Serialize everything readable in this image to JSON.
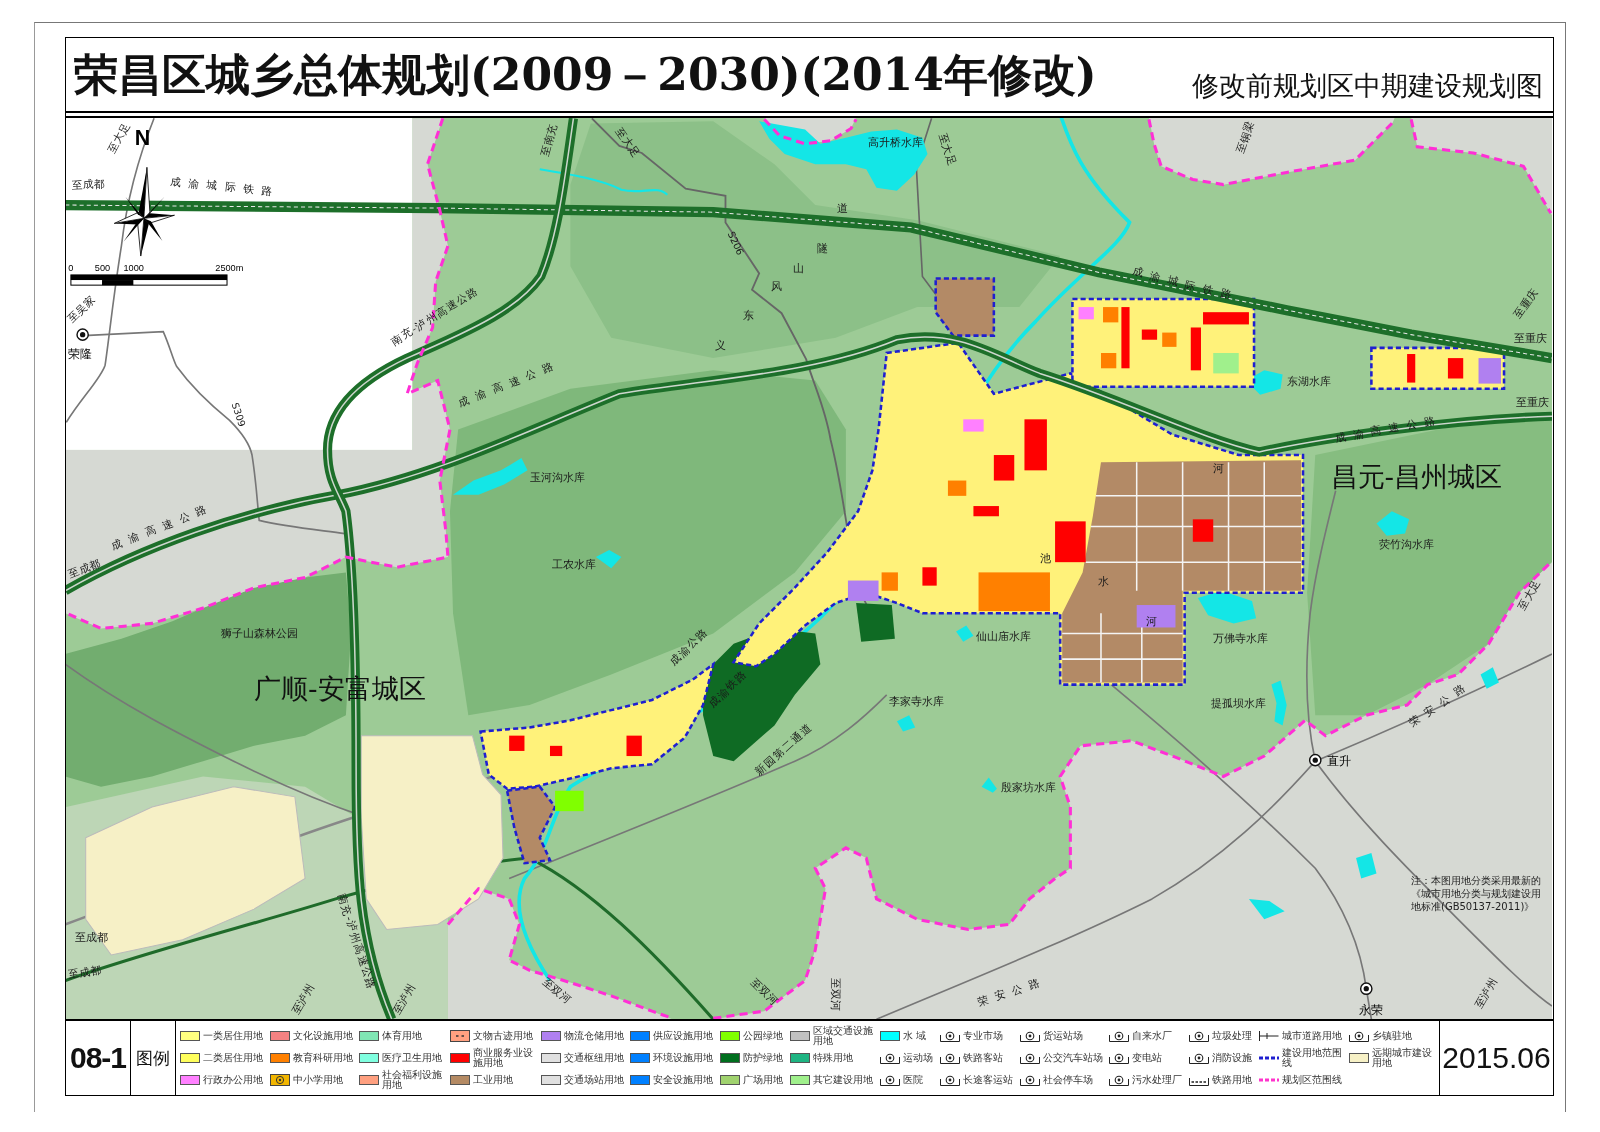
{
  "title": {
    "main": "荣昌区城乡总体规划(2009－2030)(2014年修改)",
    "subtitle": "修改前规划区中期建设规划图"
  },
  "map": {
    "north": "N",
    "scale_labels": [
      "0",
      "500",
      "1000",
      "2500m"
    ],
    "labels": [
      {
        "text": "至大足",
        "kind": "direction"
      },
      {
        "text": "至成都",
        "kind": "direction"
      },
      {
        "text": "成渝城际铁路",
        "kind": "road"
      },
      {
        "text": "至吴家",
        "kind": "direction"
      },
      {
        "text": "荣隆",
        "kind": "town"
      },
      {
        "text": "南充-泸州高速公路",
        "kind": "highway"
      },
      {
        "text": "S309",
        "kind": "code"
      },
      {
        "text": "成渝高速公路",
        "kind": "road"
      },
      {
        "text": "玉河沟水库",
        "kind": "water"
      },
      {
        "text": "至成都",
        "kind": "direction"
      },
      {
        "text": "成渝高速公路",
        "kind": "road"
      },
      {
        "text": "至南充",
        "kind": "direction"
      },
      {
        "text": "至大足",
        "kind": "direction"
      },
      {
        "text": "高升桥水库",
        "kind": "water"
      },
      {
        "text": "至大足",
        "kind": "direction"
      },
      {
        "text": "S206",
        "kind": "code"
      },
      {
        "text": "义",
        "kind": "tunnel"
      },
      {
        "text": "东",
        "kind": "tunnel"
      },
      {
        "text": "风",
        "kind": "tunnel"
      },
      {
        "text": "山",
        "kind": "tunnel"
      },
      {
        "text": "隧",
        "kind": "tunnel"
      },
      {
        "text": "道",
        "kind": "tunnel"
      },
      {
        "text": "成渝城际铁路",
        "kind": "road"
      },
      {
        "text": "至铜梁",
        "kind": "direction"
      },
      {
        "text": "东湖水库",
        "kind": "water"
      },
      {
        "text": "至重庆",
        "kind": "direction"
      },
      {
        "text": "至重庆",
        "kind": "direction"
      },
      {
        "text": "成渝高速公路",
        "kind": "road"
      },
      {
        "text": "至重庆",
        "kind": "direction"
      },
      {
        "text": "昌元-昌州城区",
        "kind": "district"
      },
      {
        "text": "荧竹沟水库",
        "kind": "water"
      },
      {
        "text": "河",
        "kind": "river"
      },
      {
        "text": "池",
        "kind": "river"
      },
      {
        "text": "水",
        "kind": "river"
      },
      {
        "text": "河",
        "kind": "river"
      },
      {
        "text": "仙山庙水库",
        "kind": "water"
      },
      {
        "text": "万佛寺水库",
        "kind": "water"
      },
      {
        "text": "至大足",
        "kind": "direction"
      },
      {
        "text": "工农水库",
        "kind": "water"
      },
      {
        "text": "狮子山森林公园",
        "kind": "park"
      },
      {
        "text": "广顺-安富城区",
        "kind": "district"
      },
      {
        "text": "成渝公路",
        "kind": "highway"
      },
      {
        "text": "成渝铁路",
        "kind": "highway"
      },
      {
        "text": "李家寺水库",
        "kind": "water"
      },
      {
        "text": "提孤坝水库",
        "kind": "water"
      },
      {
        "text": "荣安公路",
        "kind": "road"
      },
      {
        "text": "直升",
        "kind": "town"
      },
      {
        "text": "新园第二通道",
        "kind": "highway"
      },
      {
        "text": "殷家坊水库",
        "kind": "water"
      },
      {
        "text": "至成都",
        "kind": "direction"
      },
      {
        "text": "至成都",
        "kind": "direction"
      },
      {
        "text": "南充-泸州高速公路",
        "kind": "highway"
      },
      {
        "text": "至泸州",
        "kind": "direction"
      },
      {
        "text": "至泸州",
        "kind": "direction"
      },
      {
        "text": "至双河",
        "kind": "direction"
      },
      {
        "text": "至双河",
        "kind": "direction"
      },
      {
        "text": "至双河",
        "kind": "direction"
      },
      {
        "text": "荣安公路",
        "kind": "road"
      },
      {
        "text": "永荣",
        "kind": "town"
      },
      {
        "text": "至泸州",
        "kind": "direction"
      }
    ],
    "note": "注：本图用地分类采用最新的《城市用地分类与规划建设用地标准(GB50137-2011)》"
  },
  "footer": {
    "sheet_number": "08-1",
    "legend_title": "图例",
    "legend": [
      {
        "label": "一类居住用地",
        "kind": "swatch",
        "color": "#ffff80"
      },
      {
        "label": "二类居住用地",
        "kind": "swatch",
        "color": "#ffff5c"
      },
      {
        "label": "行政办公用地",
        "kind": "swatch",
        "color": "#ff80ff"
      },
      {
        "label": "文化设施用地",
        "kind": "swatch",
        "color": "#f58282"
      },
      {
        "label": "教育科研用地",
        "kind": "swatch",
        "color": "#ff8000"
      },
      {
        "label": "中小学用地",
        "kind": "symbol-swatch",
        "color": "#f2b600"
      },
      {
        "label": "体育用地",
        "kind": "swatch",
        "color": "#80e6b4"
      },
      {
        "label": "医疗卫生用地",
        "kind": "swatch",
        "color": "#80ffe0"
      },
      {
        "label": "社会福利设施用地",
        "kind": "swatch",
        "color": "#ffa080"
      },
      {
        "label": "文物古迹用地",
        "kind": "hatched",
        "color": "#ffa080"
      },
      {
        "label": "商业服务业设施用地",
        "kind": "swatch",
        "color": "#ff0000"
      },
      {
        "label": "工业用地",
        "kind": "swatch",
        "color": "#b48a64"
      },
      {
        "label": "物流仓储用地",
        "kind": "swatch",
        "color": "#b080f0"
      },
      {
        "label": "交通枢纽用地",
        "kind": "swatch",
        "color": "#e0e0e0"
      },
      {
        "label": "交通场站用地",
        "kind": "swatch",
        "color": "#e0e0e0"
      },
      {
        "label": "供应设施用地",
        "kind": "swatch",
        "color": "#0080ff"
      },
      {
        "label": "环境设施用地",
        "kind": "swatch",
        "color": "#0080ff"
      },
      {
        "label": "安全设施用地",
        "kind": "swatch",
        "color": "#0080ff"
      },
      {
        "label": "公园绿地",
        "kind": "swatch",
        "color": "#80ff00"
      },
      {
        "label": "防护绿地",
        "kind": "swatch",
        "color": "#006e1e"
      },
      {
        "label": "广场用地",
        "kind": "swatch",
        "color": "#a0d26e"
      },
      {
        "label": "区域交通设施用地",
        "kind": "swatch",
        "color": "#c0c0c0"
      },
      {
        "label": "特殊用地",
        "kind": "swatch",
        "color": "#1eb482"
      },
      {
        "label": "其它建设用地",
        "kind": "swatch",
        "color": "#a0f08c"
      },
      {
        "label": "水 域",
        "kind": "swatch",
        "color": "#00ffff"
      },
      {
        "label": "运动场",
        "kind": "symbol"
      },
      {
        "label": "医院",
        "kind": "symbol"
      },
      {
        "label": "专业市场",
        "kind": "symbol"
      },
      {
        "label": "铁路客站",
        "kind": "symbol"
      },
      {
        "label": "长途客运站",
        "kind": "symbol"
      },
      {
        "label": "货运站场",
        "kind": "symbol"
      },
      {
        "label": "公交汽车站场",
        "kind": "symbol"
      },
      {
        "label": "社会停车场",
        "kind": "symbol"
      },
      {
        "label": "自来水厂",
        "kind": "symbol"
      },
      {
        "label": "变电站",
        "kind": "symbol"
      },
      {
        "label": "污水处理厂",
        "kind": "symbol"
      },
      {
        "label": "垃圾处理",
        "kind": "symbol"
      },
      {
        "label": "消防设施",
        "kind": "symbol"
      },
      {
        "label": "铁路用地",
        "kind": "rail-line"
      },
      {
        "label": "城市道路用地",
        "kind": "road-line"
      },
      {
        "label": "建设用地范围线",
        "kind": "dashed-line",
        "color": "#1f1fd0"
      },
      {
        "label": "规划区范围线",
        "kind": "dashed-line",
        "color": "#ff33cc"
      },
      {
        "label": "乡镇驻地",
        "kind": "symbol"
      },
      {
        "label": "远期城市建设用地",
        "kind": "swatch",
        "color": "#f7f1c6"
      }
    ],
    "date": "2015.06"
  }
}
